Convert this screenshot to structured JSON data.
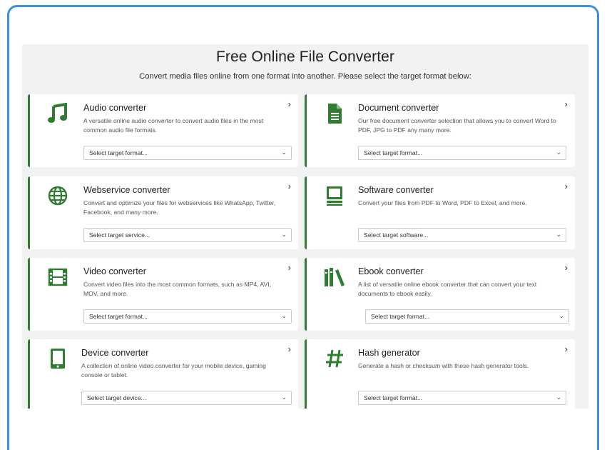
{
  "header": {
    "title": "Free Online File Converter",
    "subtitle": "Convert media files online from one format into another. Please select the target format below:"
  },
  "cards": [
    {
      "title": "Audio converter",
      "desc": "A versatile online audio converter to convert audio files in the most common audio file formats.",
      "select": "Select target format...",
      "icon": "music-note-icon"
    },
    {
      "title": "Document converter",
      "desc": "Our free document converter selection that allows you to convert Word to PDF, JPG to PDF any many more.",
      "select": "Select target format...",
      "icon": "document-icon"
    },
    {
      "title": "Webservice converter",
      "desc": "Convert and optimize your files for webservices like WhatsApp, Twitter, Facebook, and many more.",
      "select": "Select target service...",
      "icon": "globe-icon"
    },
    {
      "title": "Software converter",
      "desc": "Convert your files from PDF to Word, PDF to Excel, and more.",
      "select": "Select target software...",
      "icon": "monitor-icon"
    },
    {
      "title": "Video converter",
      "desc": "Convert video files into the most common formats, such as MP4, AVI, MOV, and more.",
      "select": "Select target format...",
      "icon": "film-icon"
    },
    {
      "title": "Ebook converter",
      "desc": "A list of versatile online ebook converter that can convert your text documents to ebook easily.",
      "select": "Select target format...",
      "icon": "books-icon"
    },
    {
      "title": "Device converter",
      "desc": "A collection of online video converter for your mobile device, gaming console or tablet.",
      "select": "Select target device...",
      "icon": "tablet-icon"
    },
    {
      "title": "Hash generator",
      "desc": "Generate a hash or checksum with these hash generator tools.",
      "select": "Select target format...",
      "icon": "hash-icon"
    }
  ],
  "colors": {
    "accent": "#2e7d32",
    "frame": "#3d8ee0",
    "panel": "#f2f2f2"
  },
  "chevron": "›",
  "caret": "⌄"
}
